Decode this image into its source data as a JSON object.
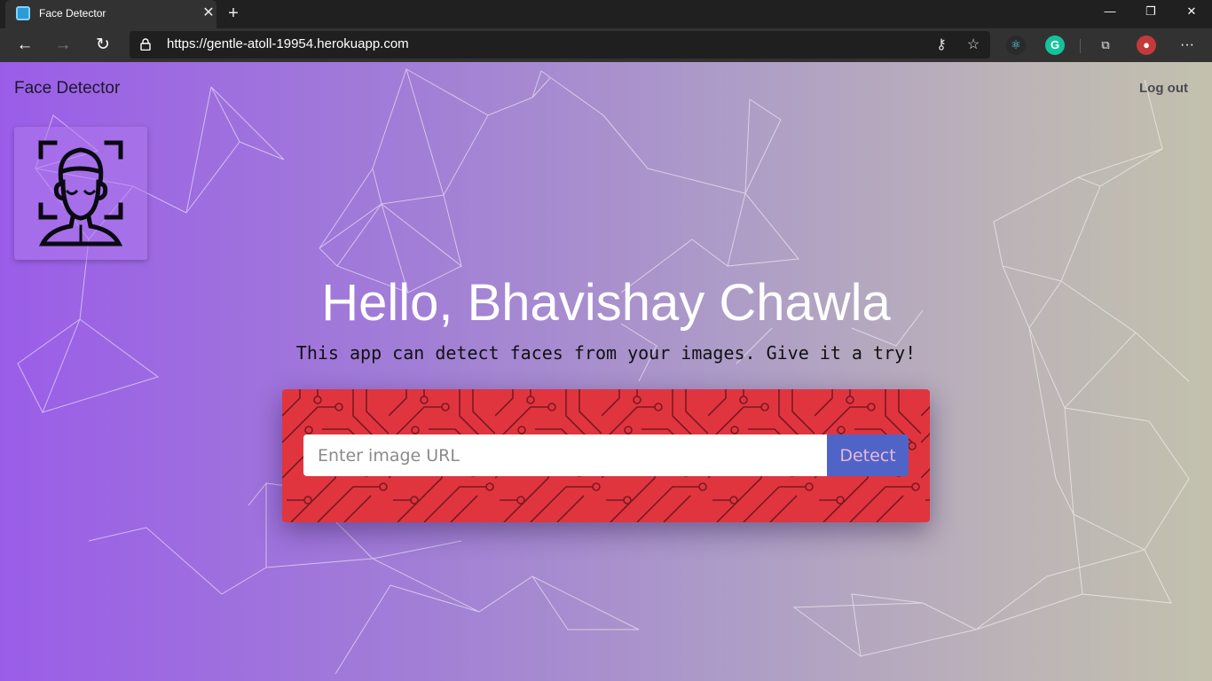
{
  "browser": {
    "tab_title": "Face Detector",
    "tab_close": "✕",
    "new_tab": "+",
    "url": "https://gentle-atoll-19954.herokuapp.com",
    "window_controls": {
      "minimize": "—",
      "restore": "❐",
      "close": "✕"
    },
    "nav": {
      "back": "←",
      "forward": "→",
      "refresh": "↻"
    },
    "address_icons": [
      "key-icon",
      "star-icon"
    ],
    "extensions": [
      "react-devtools-icon",
      "grammarly-icon",
      "collections-icon",
      "profile-avatar"
    ],
    "menu": "···"
  },
  "page": {
    "brand": "Face Detector",
    "logout": "Log out",
    "greeting": "Hello, Bhavishay Chawla",
    "subtitle": "This app can detect faces from your images. Give it a try!",
    "input_placeholder": "Enter image URL",
    "detect_button": "Detect"
  },
  "colors": {
    "gradient_start": "#9a5de8",
    "gradient_end": "#c3c1ad",
    "panel_red": "#e0353f",
    "detect_blue": "#5064c8"
  }
}
